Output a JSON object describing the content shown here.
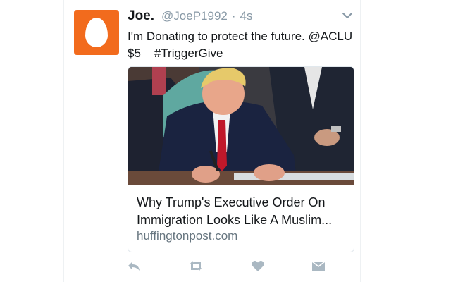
{
  "tweet": {
    "display_name": "Joe.",
    "handle": "@JoeP1992",
    "separator": "·",
    "time": "4s",
    "text_line1": "I'm Donating to protect the future. @ACLU",
    "text_amount": "$5",
    "text_hashtag": "#TriggerGive"
  },
  "card": {
    "title_line1": "Why Trump's Executive Order On",
    "title_line2": "Immigration Looks Like A Muslim...",
    "domain": "huffingtonpost.com"
  },
  "icons": {
    "avatar": "default-egg-avatar",
    "caret": "chevron-down-icon",
    "reply": "reply-icon",
    "retweet": "retweet-icon",
    "like": "heart-icon",
    "dm": "envelope-icon"
  },
  "colors": {
    "avatar_bg": "#f26b1d",
    "muted": "#8899a6",
    "action_icon": "#aab8c2",
    "text": "#14171a"
  }
}
